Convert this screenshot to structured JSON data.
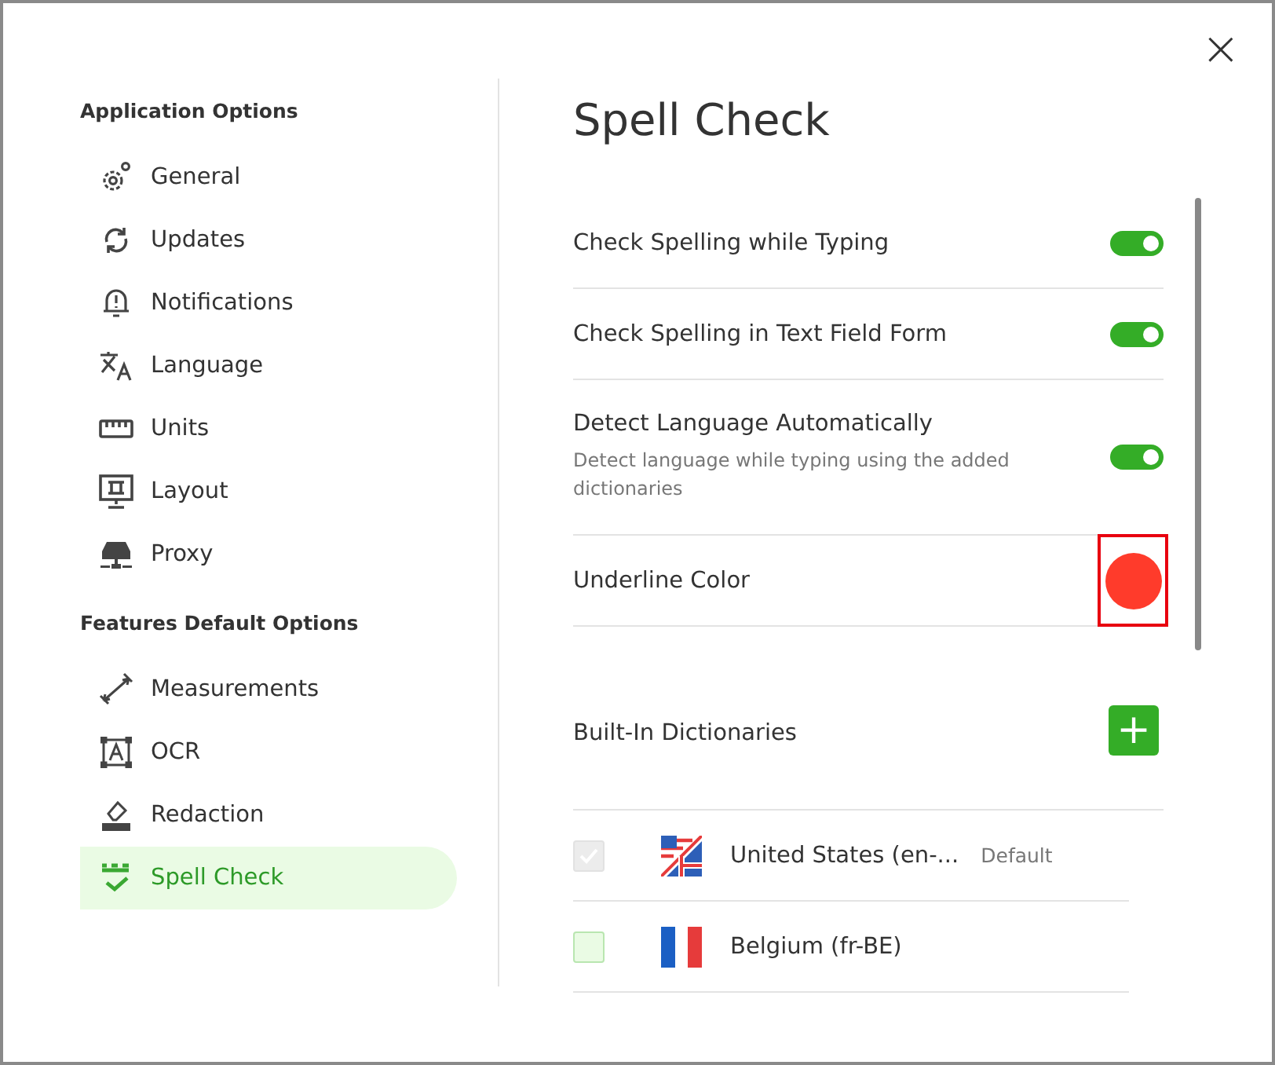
{
  "close_label": "×",
  "sidebar": {
    "sections": [
      {
        "heading": "Application Options",
        "items": [
          {
            "label": "General",
            "selected": false
          },
          {
            "label": "Updates",
            "selected": false
          },
          {
            "label": "Notifications",
            "selected": false
          },
          {
            "label": "Language",
            "selected": false
          },
          {
            "label": "Units",
            "selected": false
          },
          {
            "label": "Layout",
            "selected": false
          },
          {
            "label": "Proxy",
            "selected": false
          }
        ]
      },
      {
        "heading": "Features Default Options",
        "items": [
          {
            "label": "Measurements",
            "selected": false
          },
          {
            "label": "OCR",
            "selected": false
          },
          {
            "label": "Redaction",
            "selected": false
          },
          {
            "label": "Spell Check",
            "selected": true
          }
        ]
      }
    ]
  },
  "page_title": "Spell Check",
  "settings": [
    {
      "kind": "toggle",
      "label": "Check Spelling while Typing",
      "on": true
    },
    {
      "kind": "toggle",
      "label": "Check Spelling in Text Field Form",
      "on": true
    },
    {
      "kind": "toggle",
      "label": "Detect Language Automatically",
      "description": "Detect language while typing using the added dictionaries",
      "on": true
    },
    {
      "kind": "color",
      "label": "Underline Color",
      "color": "#ff3b2b",
      "highlighted": true
    }
  ],
  "dictionaries": {
    "title": "Built-In Dictionaries",
    "add_label": "+",
    "items": [
      {
        "name": "United States (en-...",
        "badge": "Default",
        "checked": true,
        "disabled": true
      },
      {
        "name": "Belgium (fr-BE)",
        "checked": false,
        "disabled": false
      }
    ]
  }
}
